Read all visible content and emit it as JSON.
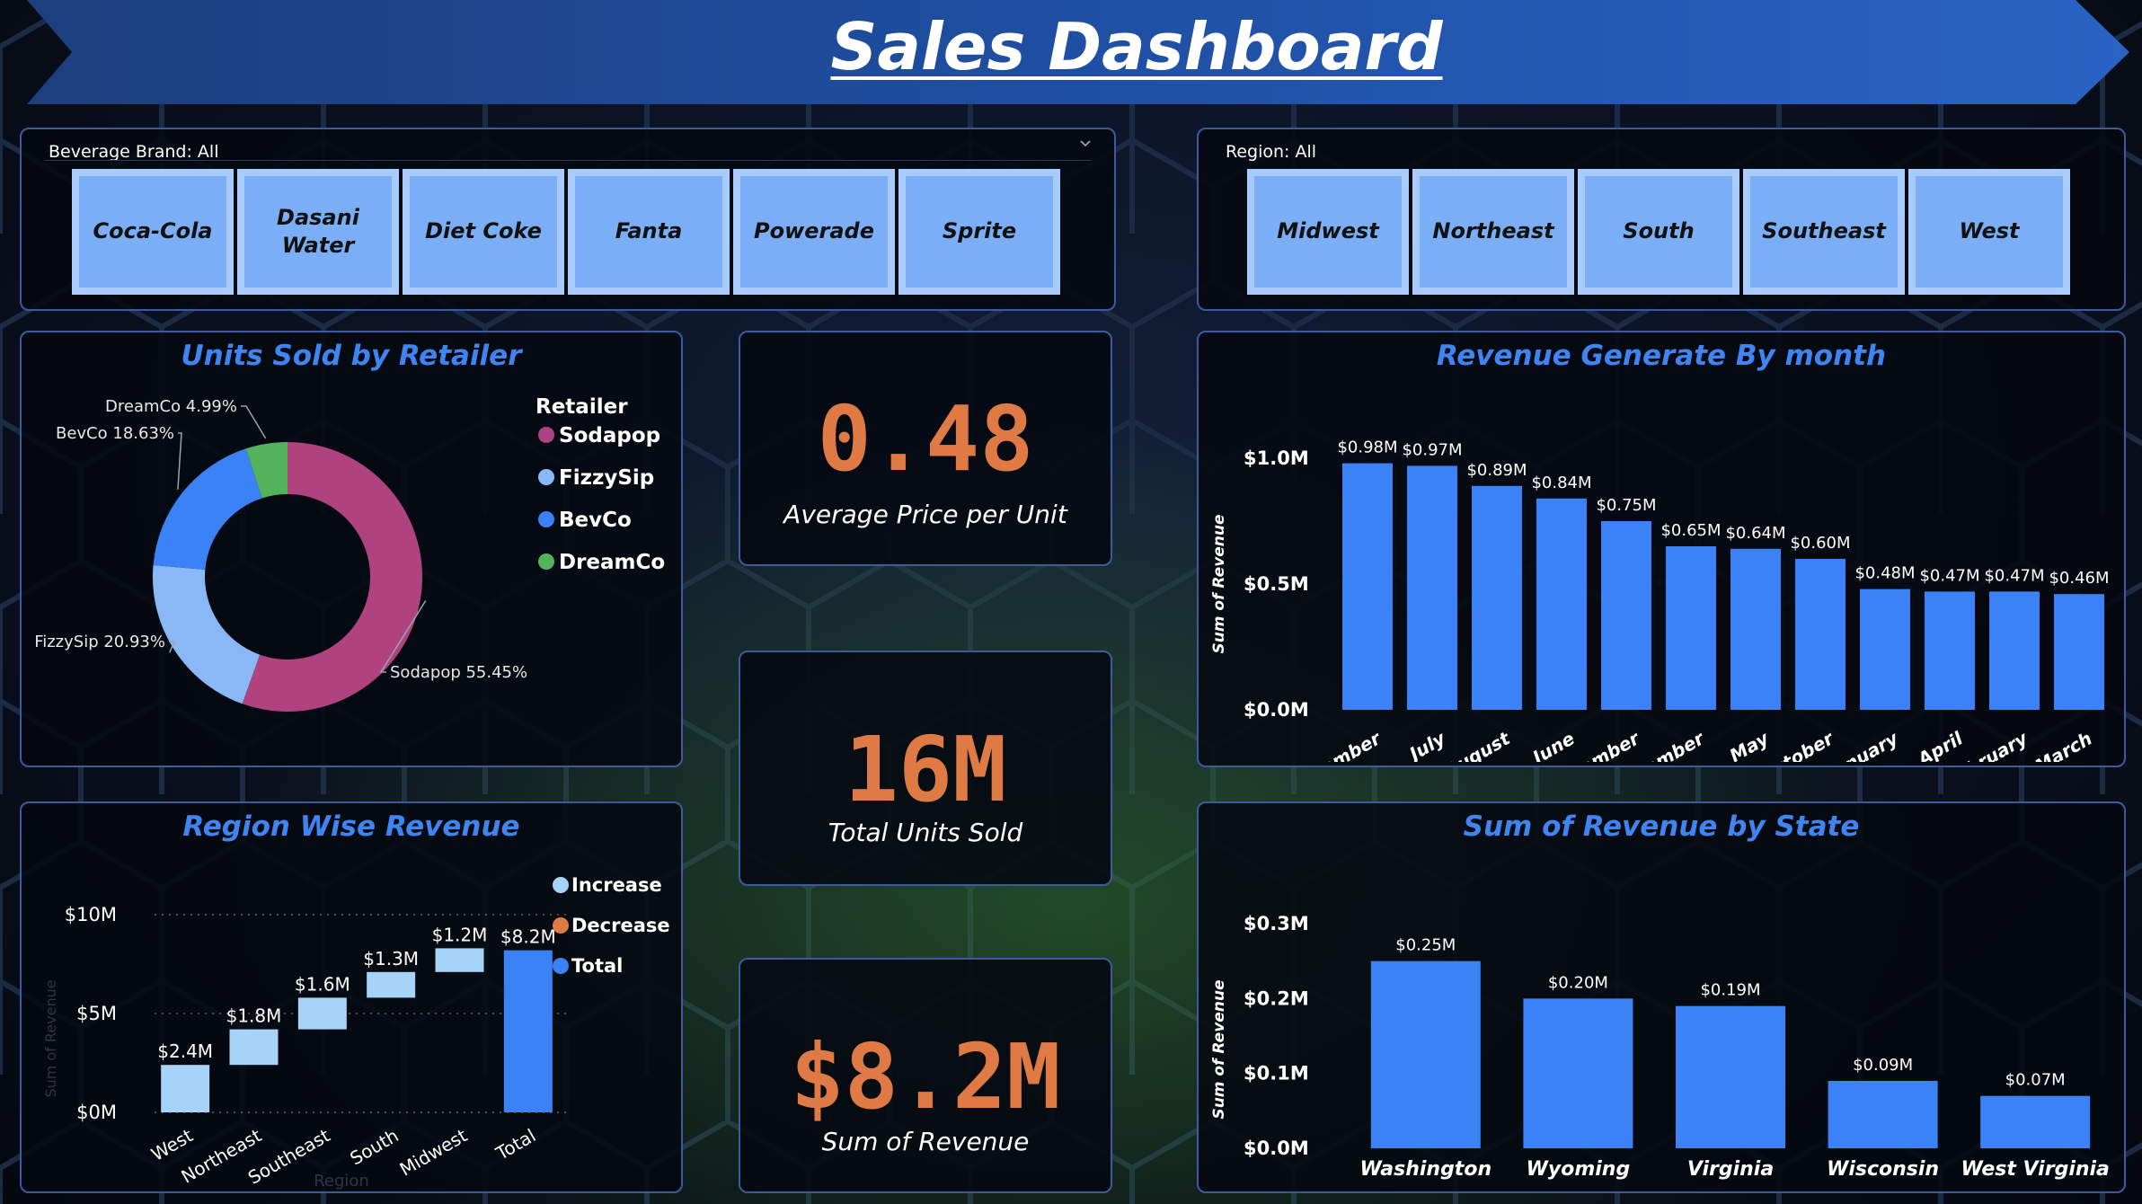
{
  "title": "Sales Dashboard",
  "brand_slicer": {
    "label": "Beverage Brand: All",
    "options": [
      "Coca-Cola",
      "Dasani Water",
      "Diet Coke",
      "Fanta",
      "Powerade",
      "Sprite"
    ]
  },
  "region_slicer": {
    "label": "Region: All",
    "options": [
      "Midwest",
      "Northeast",
      "South",
      "Southeast",
      "West"
    ]
  },
  "kpis": [
    {
      "value": "0.48",
      "label": "Average Price per Unit"
    },
    {
      "value": "16M",
      "label": "Total Units Sold"
    },
    {
      "value": "$8.2M",
      "label": "Sum of Revenue"
    }
  ],
  "colors": {
    "accent": "#3f85f2",
    "kpi": "#e07a44",
    "sodapop": "#b0427f",
    "fizzysip": "#8ab8f7",
    "bevco": "#3b82f6",
    "dreamco": "#52b35c",
    "increase": "#a6d3f7",
    "decrease": "#e07a44",
    "total": "#3b82f6"
  },
  "chart_data": [
    {
      "id": "units_by_retailer",
      "type": "pie",
      "title": "Units Sold by Retailer",
      "legend_title": "Retailer",
      "legend_position": "right",
      "slices": [
        {
          "name": "Sodapop",
          "value": 55.45,
          "label": "Sodapop 55.45%"
        },
        {
          "name": "FizzySip",
          "value": 20.93,
          "label": "FizzySip 20.93%"
        },
        {
          "name": "BevCo",
          "value": 18.63,
          "label": "BevCo 18.63%"
        },
        {
          "name": "DreamCo",
          "value": 4.99,
          "label": "DreamCo 4.99%"
        }
      ]
    },
    {
      "id": "region_wise_revenue",
      "type": "bar",
      "subtype": "waterfall",
      "title": "Region Wise Revenue",
      "xlabel": "Region",
      "ylabel": "Sum of Revenue",
      "ylim": [
        0,
        10
      ],
      "y_ticks": [
        "$0M",
        "$5M",
        "$10M"
      ],
      "legend": [
        "Increase",
        "Decrease",
        "Total"
      ],
      "legend_position": "right",
      "categories": [
        "West",
        "Northeast",
        "Southeast",
        "South",
        "Midwest",
        "Total"
      ],
      "values": [
        2.4,
        1.8,
        1.6,
        1.3,
        1.2,
        8.2
      ],
      "labels": [
        "$2.4M",
        "$1.8M",
        "$1.6M",
        "$1.3M",
        "$1.2M",
        "$8.2M"
      ],
      "kinds": [
        "increase",
        "increase",
        "increase",
        "increase",
        "increase",
        "total"
      ]
    },
    {
      "id": "revenue_by_month",
      "type": "bar",
      "title": "Revenue Generate By month",
      "ylabel": "Sum of Revenue",
      "ylim": [
        0,
        1.0
      ],
      "y_ticks": [
        "$0.0M",
        "$0.5M",
        "$1.0M"
      ],
      "categories": [
        "December",
        "July",
        "August",
        "June",
        "November",
        "September",
        "May",
        "October",
        "January",
        "April",
        "February",
        "March"
      ],
      "values": [
        0.98,
        0.97,
        0.89,
        0.84,
        0.75,
        0.65,
        0.64,
        0.6,
        0.48,
        0.47,
        0.47,
        0.46
      ],
      "labels": [
        "$0.98M",
        "$0.97M",
        "$0.89M",
        "$0.84M",
        "$0.75M",
        "$0.65M",
        "$0.64M",
        "$0.60M",
        "$0.48M",
        "$0.47M",
        "$0.47M",
        "$0.46M"
      ]
    },
    {
      "id": "revenue_by_state",
      "type": "bar",
      "title": "Sum of Revenue by State",
      "ylabel": "Sum of Revenue",
      "ylim": [
        0,
        0.3
      ],
      "y_ticks": [
        "$0.0M",
        "$0.1M",
        "$0.2M",
        "$0.3M"
      ],
      "categories": [
        "Washington",
        "Wyoming",
        "Virginia",
        "Wisconsin",
        "West Virginia"
      ],
      "values": [
        0.25,
        0.2,
        0.19,
        0.09,
        0.07
      ],
      "labels": [
        "$0.25M",
        "$0.20M",
        "$0.19M",
        "$0.09M",
        "$0.07M"
      ]
    }
  ]
}
